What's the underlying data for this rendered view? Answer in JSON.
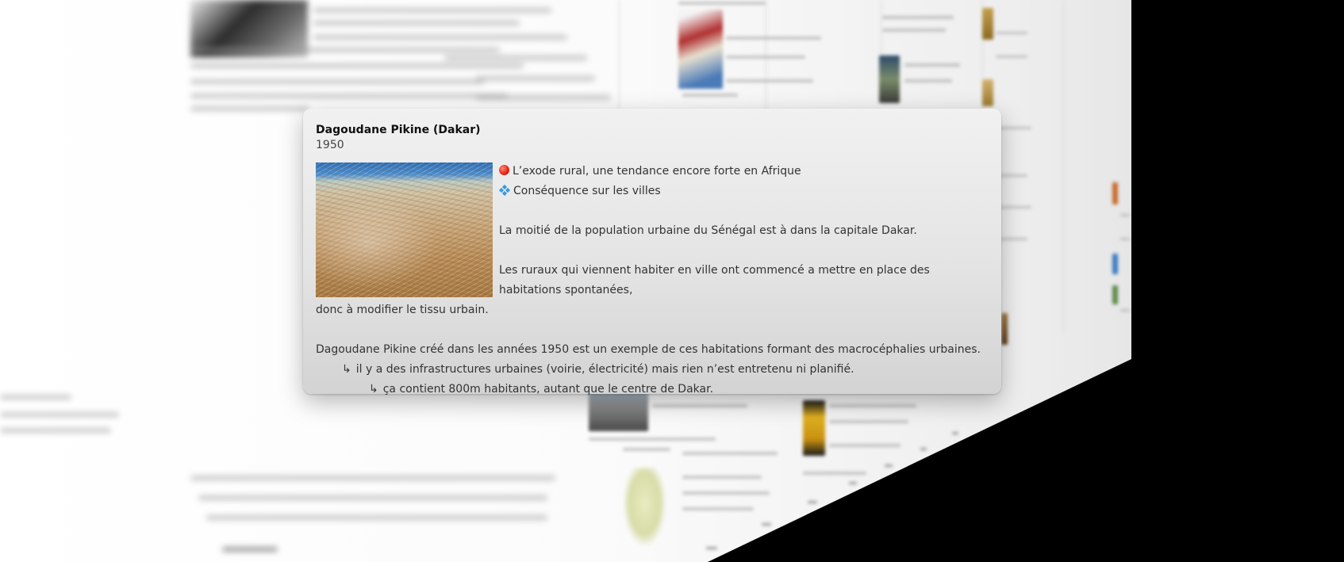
{
  "popup": {
    "title": "Dagoudane Pikine (Dakar)",
    "date": "1950",
    "image_icon": "aerial-city-photo",
    "tags": [
      {
        "icon": "red-circle-icon",
        "label": "L’exode rural, une tendance encore forte en Afrique"
      },
      {
        "icon": "blue-diamond-icon",
        "label": "Conséquence sur les villes"
      }
    ],
    "paragraph1": "La moitié de la population urbaine du Sénégal est à dans la capitale Dakar.",
    "paragraph2_line1": "Les ruraux qui viennent habiter en ville ont commencé a mettre en place des habitations spontanées,",
    "paragraph2_line2": "donc à modifier le tissu urbain.",
    "paragraph3": "Dagoudane Pikine créé dans les années 1950 est un exemple de ces habitations formant des macrocéphalies urbaines.",
    "arrow_symbol": "↳",
    "arrow_line1": "il y a des infrastructures urbaines (voirie, électricité) mais rien n’est entretenu ni planifié.",
    "arrow_line2": "ça contient 800m habitants, autant que le centre de Dakar."
  },
  "colors": {
    "tag_red": "#e8281a",
    "tag_blue": "#3b9be0",
    "background": "#000000"
  }
}
